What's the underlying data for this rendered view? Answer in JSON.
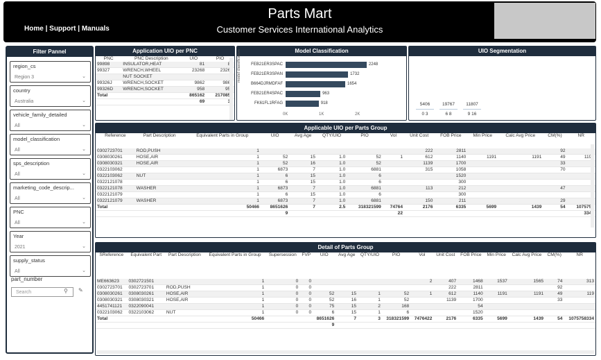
{
  "header": {
    "title": "Parts Mart",
    "subtitle": "Customer Services International Analytics",
    "nav": [
      "Home",
      "Support",
      "Manuals"
    ]
  },
  "filter_panel": {
    "title": "Filter Pannel",
    "filters": [
      {
        "label": "region_cs",
        "value": "Region 3"
      },
      {
        "label": "country",
        "value": "Australia"
      },
      {
        "label": "vehicle_family_detailed",
        "value": "All"
      },
      {
        "label": "model_classification",
        "value": "All"
      },
      {
        "label": "sps_description",
        "value": "All"
      },
      {
        "label": "marketing_code_descrip...",
        "value": "All"
      },
      {
        "label": "PNC",
        "value": "All"
      },
      {
        "label": "Year",
        "value": "2021"
      },
      {
        "label": "supply_status",
        "value": "All"
      }
    ],
    "part_number": {
      "label": "part_number",
      "placeholder": "Search"
    }
  },
  "app_uio": {
    "title": "Application UIO per PNC",
    "columns": [
      "PNC",
      "PNC Description",
      "UIO",
      "PIO"
    ],
    "rows": [
      [
        "99898",
        "INSULATOR,HEAT",
        "81",
        "81"
      ],
      [
        "99327",
        "WRENCH,WHEEL",
        "23268",
        "23268"
      ],
      [
        "",
        "NUT SOCKET",
        "",
        ""
      ],
      [
        "99326J",
        "WRENCH,SOCKET",
        "9862",
        "9862"
      ],
      [
        "99326D",
        "WRENCH,SOCKET",
        "958",
        "958"
      ]
    ],
    "total": [
      "Total",
      "",
      "865162",
      "2170859"
    ],
    "total2": [
      "",
      "",
      "69",
      "38"
    ]
  },
  "model_class": {
    "title": "Model Classification",
    "axis_label": "model classification"
  },
  "chart_data": {
    "type": "bar",
    "categories": [
      "FEB21ER3SPAC",
      "FEB21ER3SPAN",
      "B664DJRMDFAF",
      "FEB21ER4SPAC",
      "FK61FL1RFAG"
    ],
    "values": [
      2248,
      1732,
      1654,
      963,
      918
    ],
    "xticks": [
      "0K",
      "1K",
      "2K"
    ],
    "xlim": [
      0,
      2500
    ]
  },
  "uio_seg": {
    "title": "UIO Segmentation",
    "items": [
      {
        "top": "5406",
        "bottom": "0 3"
      },
      {
        "top": "19767",
        "bottom": "6 8"
      },
      {
        "top": "11807",
        "bottom": "9 16"
      }
    ]
  },
  "applicable": {
    "title": "Applicable UIO per Parts Group",
    "columns": [
      "Reference",
      "Part Description",
      "Equivalent Parts in Group",
      "UIO",
      "Avg Age",
      "QTY/UIO",
      "PIO",
      "Vol",
      "Unit Cost",
      "FOB Price",
      "Min Price",
      "Calc Avg Price",
      "CM(%)",
      "NR"
    ],
    "rows": [
      [
        "0302723701",
        "ROD,PUSH",
        "1",
        "",
        "",
        "",
        "",
        "",
        "222",
        "2811",
        "",
        "",
        "92",
        ""
      ],
      [
        "0308030261",
        "HOSE,AIR",
        "1",
        "52",
        "15",
        "1.0",
        "52",
        "1",
        "612",
        "1140",
        "1191",
        "1191",
        "49",
        "1191"
      ],
      [
        "0308030321",
        "HOSE,AIR",
        "1",
        "52",
        "16",
        "1.0",
        "52",
        "",
        "1139",
        "1700",
        "",
        "",
        "33",
        ""
      ],
      [
        "0322103062",
        "",
        "1",
        "6873",
        "7",
        "1.0",
        "6881",
        "",
        "315",
        "1058",
        "",
        "",
        "70",
        ""
      ],
      [
        "0322103062",
        "NUT",
        "1",
        "6",
        "15",
        "1.0",
        "6",
        "",
        "",
        "1520",
        "",
        "",
        "",
        ""
      ],
      [
        "0322121078",
        "",
        "1",
        "6",
        "15",
        "1.0",
        "6",
        "",
        "",
        "300",
        "",
        "",
        "",
        ""
      ],
      [
        "0322121078",
        "WASHER",
        "1",
        "6873",
        "7",
        "1.0",
        "6881",
        "",
        "113",
        "212",
        "",
        "",
        "47",
        ""
      ],
      [
        "0322121079",
        "",
        "1",
        "6",
        "15",
        "1.0",
        "6",
        "",
        "",
        "300",
        "",
        "",
        "",
        ""
      ],
      [
        "0322121079",
        "WASHER",
        "1",
        "6873",
        "7",
        "1.0",
        "6881",
        "",
        "150",
        "211",
        "",
        "",
        "29",
        ""
      ]
    ],
    "total": [
      "Total",
      "",
      "50466",
      "8651626",
      "7",
      "2.5",
      "318321599",
      "74764",
      "2176",
      "6335",
      "5699",
      "1439",
      "54",
      "1075758"
    ],
    "total2": [
      "",
      "",
      "",
      "9",
      "",
      "",
      "",
      "22",
      "",
      "",
      "",
      "",
      "",
      "3340"
    ]
  },
  "detail": {
    "title": "Detail of Parts Group",
    "columns": [
      "SReference",
      "Equivalent Part",
      "Part Description",
      "Equivalent Parts in Group",
      "Supersession",
      "FVP",
      "UIO",
      "Avg Age",
      "QTY/UIO",
      "PIO",
      "Vol",
      "Unit Cost",
      "FOB Price",
      "Min Price",
      "Calc Avg Price",
      "CM(%)",
      "NR"
    ],
    "rows": [
      [
        "ME663623",
        "0302721501",
        "",
        "1",
        "0",
        "0",
        "",
        "",
        "",
        "",
        "2",
        "407",
        "1468",
        "1537",
        "1565",
        "74",
        "313"
      ],
      [
        "0302723701",
        "0302723701",
        "ROD,PUSH",
        "1",
        "0",
        "0",
        "",
        "",
        "",
        "",
        "",
        "222",
        "2811",
        "",
        "",
        "92",
        ""
      ],
      [
        "0308030261",
        "0308030261",
        "HOSE,AIR",
        "1",
        "0",
        "0",
        "52",
        "15",
        "1",
        "52",
        "1",
        "612",
        "1140",
        "1191",
        "1191",
        "49",
        "119"
      ],
      [
        "0308030321",
        "0308030321",
        "HOSE,AIR",
        "1",
        "0",
        "0",
        "52",
        "16",
        "1",
        "52",
        "",
        "1139",
        "1700",
        "",
        "",
        "33",
        ""
      ],
      [
        "4451741121",
        "0322090041",
        "",
        "1",
        "0",
        "0",
        "75",
        "15",
        "2",
        "168",
        "",
        "",
        "54",
        "",
        "",
        "",
        ""
      ],
      [
        "0322103062",
        "0322103062",
        "NUT",
        "1",
        "0",
        "0",
        "6",
        "15",
        "1",
        "6",
        "",
        "",
        "1520",
        "",
        "",
        "",
        ""
      ]
    ],
    "total": [
      "Total",
      "",
      "",
      "50466",
      "",
      "",
      "8651626",
      "7",
      "3",
      "318321599",
      "7476422",
      "2176",
      "6335",
      "5699",
      "1439",
      "54",
      "1075758334"
    ],
    "total2": [
      "",
      "",
      "",
      "",
      "",
      "",
      "9",
      "",
      "",
      "",
      "",
      "",
      "",
      "",
      "",
      "",
      ""
    ]
  }
}
